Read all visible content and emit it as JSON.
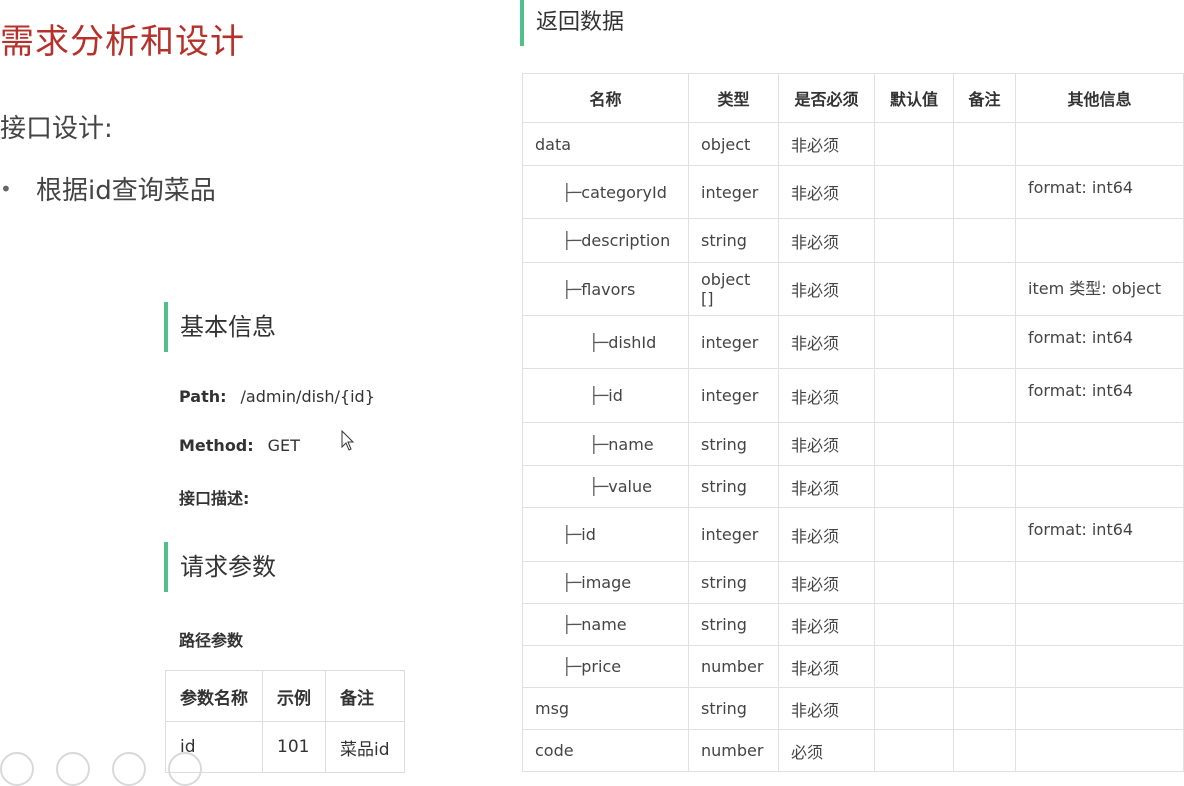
{
  "slide": {
    "title": "需求分析和设计",
    "subtitle": "接口设计:",
    "bullet": "根据id查询菜品"
  },
  "basic": {
    "heading": "基本信息",
    "path_label": "Path:",
    "path_value": "/admin/dish/{id}",
    "method_label": "Method:",
    "method_value": "GET",
    "desc_label": "接口描述:"
  },
  "request": {
    "heading": "请求参数",
    "path_params_label": "路径参数",
    "columns": [
      "参数名称",
      "示例",
      "备注"
    ],
    "rows": [
      [
        "id",
        "101",
        "菜品id"
      ]
    ]
  },
  "response": {
    "heading": "返回数据",
    "columns": [
      "名称",
      "类型",
      "是否必须",
      "默认值",
      "备注",
      "其他信息"
    ],
    "rows": [
      {
        "name": "data",
        "indent": 0,
        "type": "object",
        "required": "非必须",
        "default": "",
        "note": "",
        "other": ""
      },
      {
        "name": "categoryId",
        "indent": 1,
        "type": "integer",
        "required": "非必须",
        "default": "",
        "note": "",
        "other": "format: int64"
      },
      {
        "name": "description",
        "indent": 1,
        "type": "string",
        "required": "非必须",
        "default": "",
        "note": "",
        "other": ""
      },
      {
        "name": "flavors",
        "indent": 1,
        "type": "object []",
        "required": "非必须",
        "default": "",
        "note": "",
        "other": "item 类型: object"
      },
      {
        "name": "dishId",
        "indent": 2,
        "type": "integer",
        "required": "非必须",
        "default": "",
        "note": "",
        "other": "format: int64"
      },
      {
        "name": "id",
        "indent": 2,
        "type": "integer",
        "required": "非必须",
        "default": "",
        "note": "",
        "other": "format: int64"
      },
      {
        "name": "name",
        "indent": 2,
        "type": "string",
        "required": "非必须",
        "default": "",
        "note": "",
        "other": ""
      },
      {
        "name": "value",
        "indent": 2,
        "type": "string",
        "required": "非必须",
        "default": "",
        "note": "",
        "other": ""
      },
      {
        "name": "id",
        "indent": 1,
        "type": "integer",
        "required": "非必须",
        "default": "",
        "note": "",
        "other": "format: int64"
      },
      {
        "name": "image",
        "indent": 1,
        "type": "string",
        "required": "非必须",
        "default": "",
        "note": "",
        "other": ""
      },
      {
        "name": "name",
        "indent": 1,
        "type": "string",
        "required": "非必须",
        "default": "",
        "note": "",
        "other": ""
      },
      {
        "name": "price",
        "indent": 1,
        "type": "number",
        "required": "非必须",
        "default": "",
        "note": "",
        "other": ""
      },
      {
        "name": "msg",
        "indent": 0,
        "type": "string",
        "required": "非必须",
        "default": "",
        "note": "",
        "other": ""
      },
      {
        "name": "code",
        "indent": 0,
        "type": "number",
        "required": "必须",
        "default": "",
        "note": "",
        "other": ""
      }
    ]
  },
  "icons": {
    "cursor": "mouse-pointer-icon",
    "toolbar": [
      "pen-icon",
      "slides-icon",
      "zoom-icon",
      "more-icon"
    ]
  },
  "colors": {
    "title": "#b5312a",
    "accent_bar": "#4fc08d"
  }
}
